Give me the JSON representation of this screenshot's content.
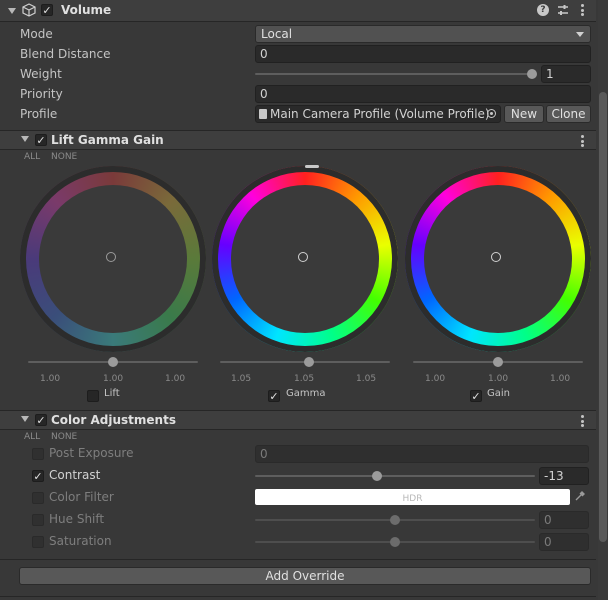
{
  "component": {
    "title": "Volume",
    "enabled": true,
    "header_icons": [
      "help-icon",
      "preset-icon",
      "kebab-menu-icon"
    ]
  },
  "volume": {
    "mode": {
      "label": "Mode",
      "value": "Local"
    },
    "blend_distance": {
      "label": "Blend Distance",
      "value": "0"
    },
    "weight": {
      "label": "Weight",
      "value": "1",
      "slider_fraction": 1.0
    },
    "priority": {
      "label": "Priority",
      "value": "0"
    },
    "profile": {
      "label": "Profile",
      "value": "Main Camera Profile (Volume Profile)",
      "new_label": "New",
      "clone_label": "Clone"
    }
  },
  "lift_gamma_gain": {
    "title": "Lift Gamma Gain",
    "all_label": "ALL",
    "none_label": "NONE",
    "wheels": [
      {
        "name": "Lift",
        "enabled": false,
        "values": [
          "1.00",
          "1.00",
          "1.00"
        ]
      },
      {
        "name": "Gamma",
        "enabled": true,
        "values": [
          "1.05",
          "1.05",
          "1.05"
        ]
      },
      {
        "name": "Gain",
        "enabled": true,
        "values": [
          "1.00",
          "1.00",
          "1.00"
        ]
      }
    ]
  },
  "color_adjustments": {
    "title": "Color Adjustments",
    "all_label": "ALL",
    "none_label": "NONE",
    "post_exposure": {
      "label": "Post Exposure",
      "value": "0",
      "enabled": false
    },
    "contrast": {
      "label": "Contrast",
      "value": "-13",
      "enabled": true
    },
    "color_filter": {
      "label": "Color Filter",
      "value": "HDR",
      "enabled": false
    },
    "hue_shift": {
      "label": "Hue Shift",
      "value": "0",
      "enabled": false
    },
    "saturation": {
      "label": "Saturation",
      "value": "0",
      "enabled": false
    }
  },
  "add_override_label": "Add Override",
  "colors": {
    "panel_bg": "#383838",
    "header_bg": "#3e3e3e",
    "field_bg": "#2a2a2a",
    "button_bg": "#585858"
  }
}
